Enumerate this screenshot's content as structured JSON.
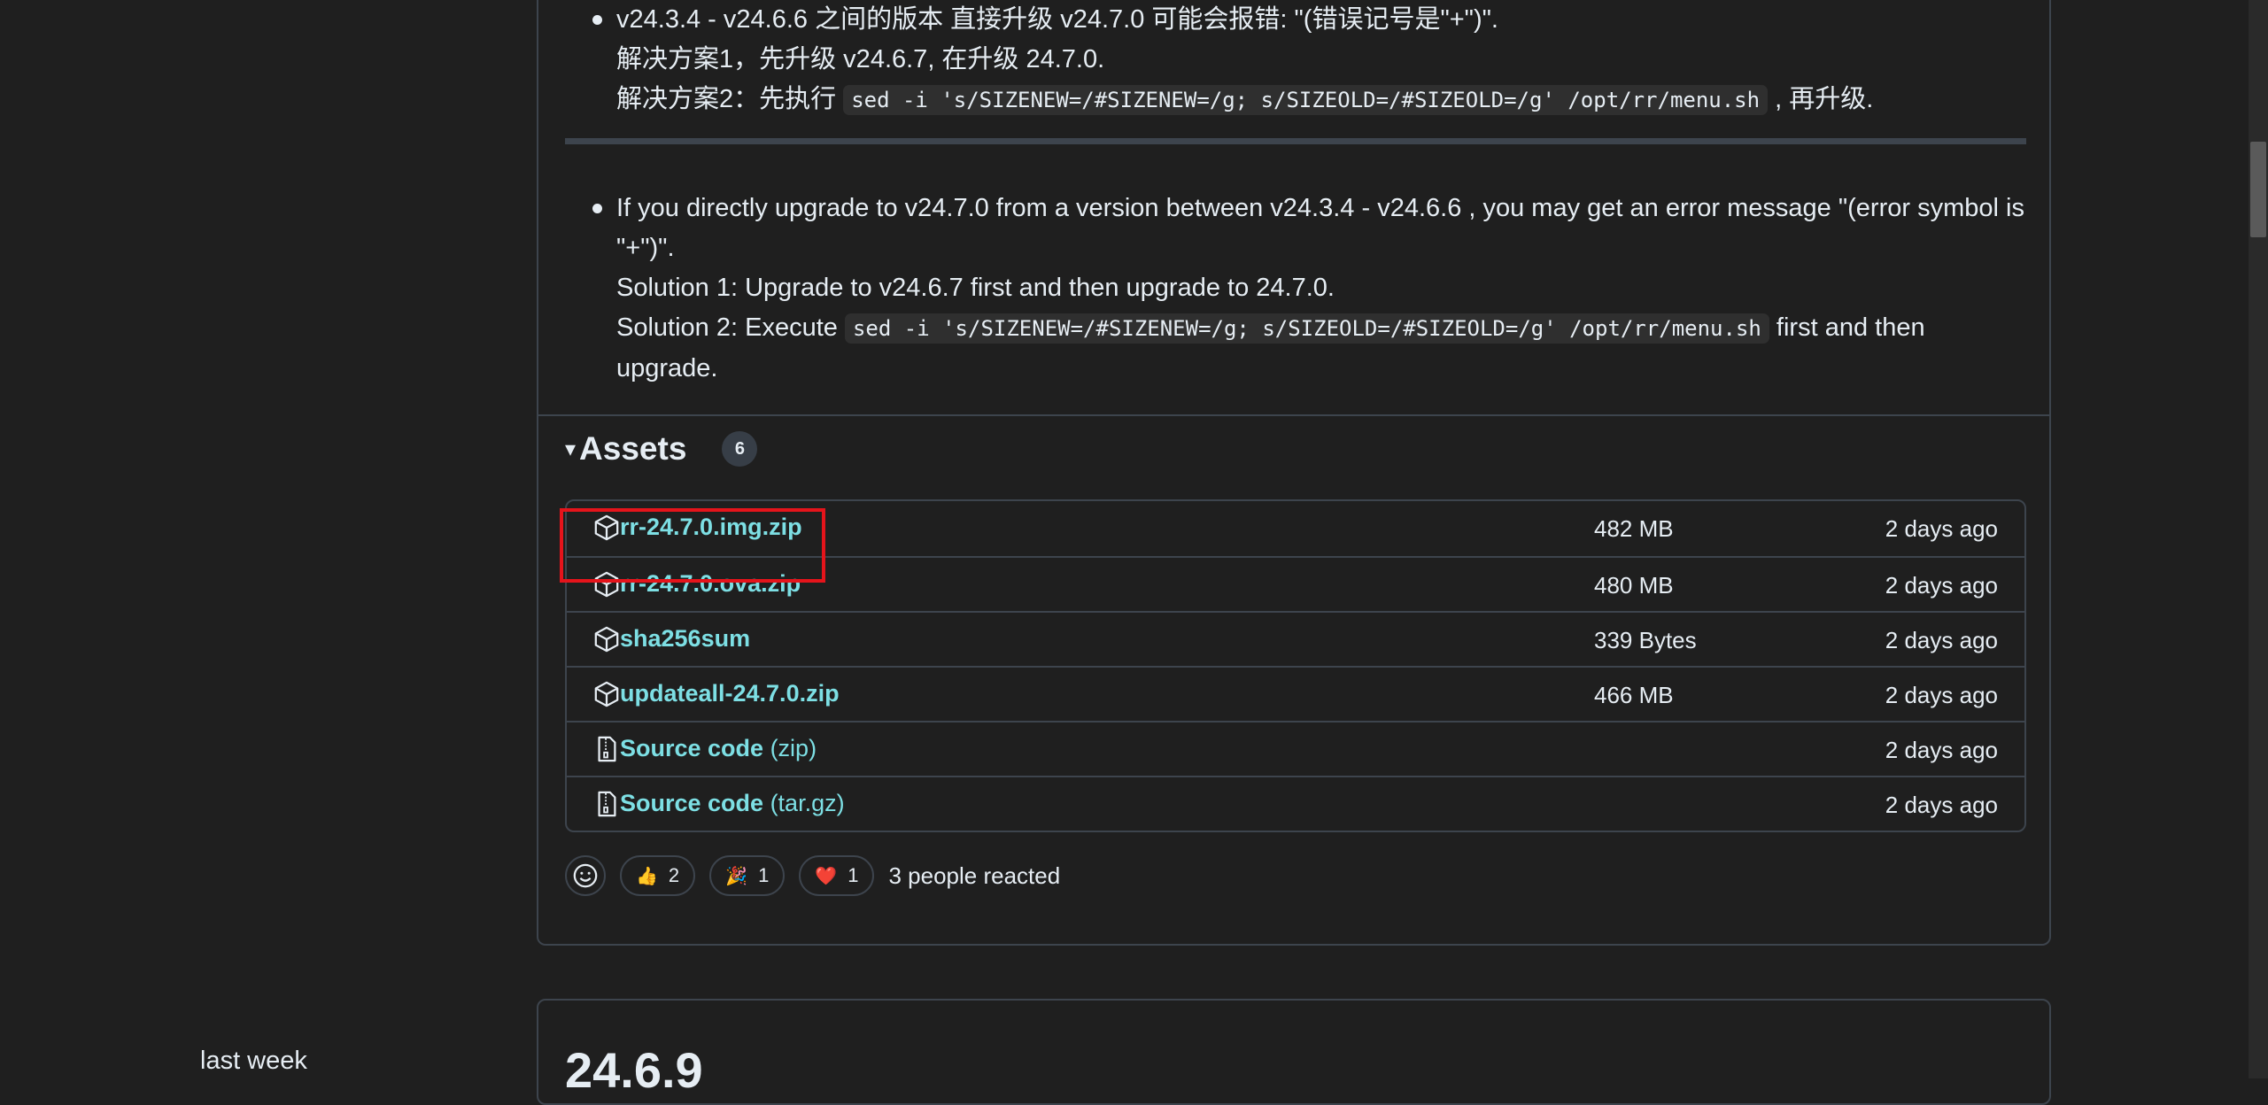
{
  "sidebar": {
    "date_label": "last week"
  },
  "release": {
    "notes_cn": {
      "line1": "v24.3.4 - v24.6.6 之间的版本 直接升级 v24.7.0 可能会报错: \"(错误记号是\"+\")\".",
      "line2": "解决方案1，先升级 v24.6.7, 在升级 24.7.0.",
      "line3_prefix": "解决方案2：先执行 ",
      "line3_code": "sed -i 's/SIZENEW=/#SIZENEW=/g; s/SIZEOLD=/#SIZEOLD=/g' /opt/rr/menu.sh",
      "line3_suffix": " , 再升级."
    },
    "notes_en": {
      "line1": "If you directly upgrade to v24.7.0 from a version between v24.3.4 - v24.6.6 , you may get an error message \"(error symbol is \"+\")\".",
      "line2": "Solution 1: Upgrade to v24.6.7 first and then upgrade to 24.7.0.",
      "line3_prefix": "Solution 2: Execute ",
      "line3_code": "sed -i 's/SIZENEW=/#SIZENEW=/g; s/SIZEOLD=/#SIZEOLD=/g' /opt/rr/menu.sh",
      "line3_suffix": " first and then upgrade."
    },
    "assets": {
      "toggle": "▾",
      "title": "Assets",
      "count": "6",
      "items": [
        {
          "name": "rr-24.7.0.img.zip",
          "suffix": "",
          "size": "482 MB",
          "date": "2 days ago",
          "icon": "package-icon"
        },
        {
          "name": "rr-24.7.0.ova.zip",
          "suffix": "",
          "size": "480 MB",
          "date": "2 days ago",
          "icon": "package-icon"
        },
        {
          "name": "sha256sum",
          "suffix": "",
          "size": "339 Bytes",
          "date": "2 days ago",
          "icon": "package-icon"
        },
        {
          "name": "updateall-24.7.0.zip",
          "suffix": "",
          "size": "466 MB",
          "date": "2 days ago",
          "icon": "package-icon"
        },
        {
          "name": "Source code",
          "suffix": " (zip)",
          "size": "",
          "date": "2 days ago",
          "icon": "file-zip-icon"
        },
        {
          "name": "Source code",
          "suffix": " (tar.gz)",
          "size": "",
          "date": "2 days ago",
          "icon": "file-zip-icon"
        }
      ]
    },
    "reactions": {
      "items": [
        {
          "emoji": "👍",
          "count": "2"
        },
        {
          "emoji": "🎉",
          "count": "1"
        },
        {
          "emoji": "❤️",
          "count": "1"
        }
      ],
      "summary": "3 people reacted"
    }
  },
  "next_release": {
    "title": "24.6.9"
  },
  "colors": {
    "background": "#1f1f1f",
    "link": "#7ddfe4",
    "border": "#3d444d",
    "highlight": "#e5141b"
  }
}
